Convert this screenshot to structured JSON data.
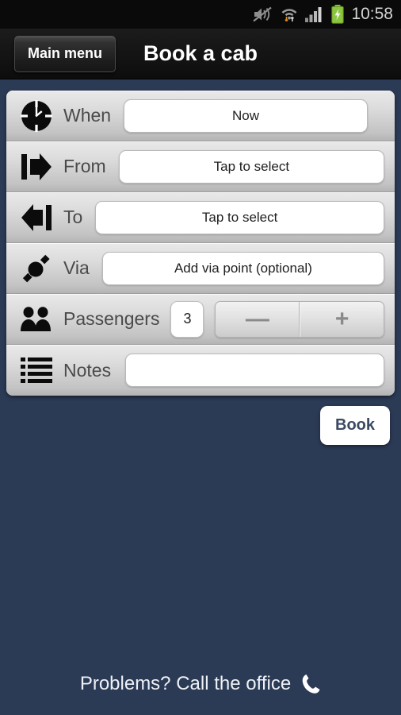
{
  "statusbar": {
    "time": "10:58",
    "icons": [
      "vibrate-mute-icon",
      "wifi-transfer-icon",
      "signal-bars-icon",
      "battery-charging-icon"
    ]
  },
  "actionbar": {
    "menu_button": "Main menu",
    "title": "Book a cab"
  },
  "form": {
    "rows": [
      {
        "icon": "clock-icon",
        "label": "When",
        "value": "Now"
      },
      {
        "icon": "from-arrow-icon",
        "label": "From",
        "value": "Tap to select"
      },
      {
        "icon": "to-arrow-icon",
        "label": "To",
        "value": "Tap to select"
      },
      {
        "icon": "via-point-icon",
        "label": "Via",
        "value": "Add via point (optional)"
      },
      {
        "icon": "passengers-icon",
        "label": "Passengers",
        "value": "3"
      },
      {
        "icon": "notes-list-icon",
        "label": "Notes",
        "value": ""
      }
    ],
    "stepper": {
      "minus": "—",
      "plus": "+"
    }
  },
  "book_button": {
    "label": "Book"
  },
  "footer": {
    "text": "Problems? Call the office",
    "icon": "phone-icon"
  },
  "colors": {
    "background": "#2b3a55",
    "actionbar": "#141414",
    "statusbar": "#0a0a0a",
    "battery_green": "#8cc63e",
    "book_text": "#3b4a63"
  }
}
